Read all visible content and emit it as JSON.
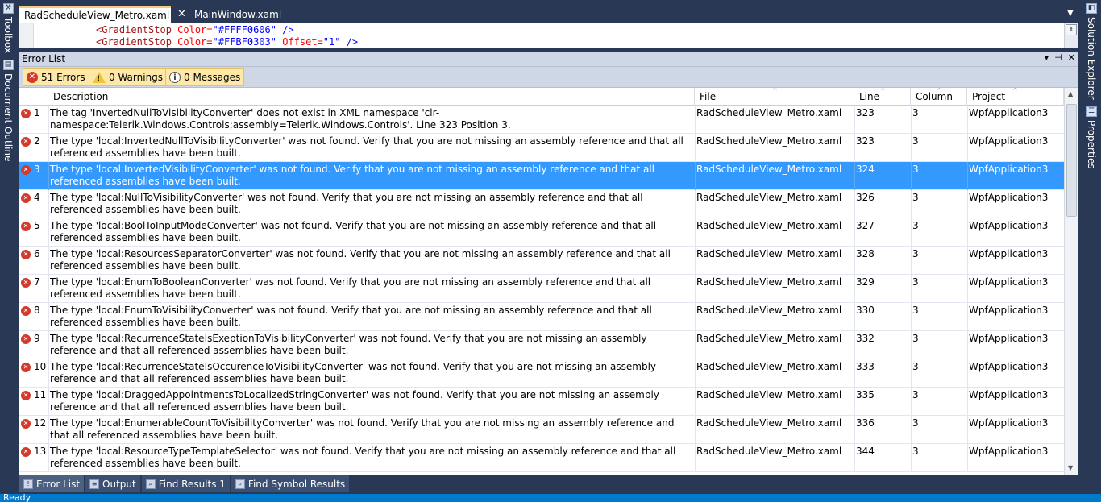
{
  "left_toolstrip": {
    "toolbox_label": "Toolbox",
    "doc_outline_label": "Document Outline"
  },
  "right_toolstrip": {
    "solution_explorer_label": "Solution Explorer",
    "properties_label": "Properties"
  },
  "doc_tabs": {
    "active": "RadScheduleView_Metro.xaml",
    "inactive": "MainWindow.xaml",
    "close_glyph": "✕",
    "dropdown_glyph": "▼"
  },
  "editor": {
    "lines": [
      {
        "tag": "<GradientStop",
        "attr": "Color=",
        "val": "\"#FFFF0606\"",
        "end": " />"
      },
      {
        "tag": "<GradientStop",
        "attr": "Color=",
        "val": "\"#FFBF0303\"",
        "attr2": " Offset=",
        "val2": "\"1\"",
        "end": " />"
      }
    ]
  },
  "error_list": {
    "title": "Error List",
    "controls": [
      "▾",
      "⊣",
      "✕"
    ],
    "filters": {
      "errors": "51 Errors",
      "warnings": "0 Warnings",
      "messages": "0 Messages"
    },
    "columns": {
      "description": "Description",
      "file": "File",
      "line": "Line",
      "column": "Column",
      "project": "Project"
    },
    "selected_index": 2,
    "rows": [
      {
        "num": "1",
        "desc": "The tag 'InvertedNullToVisibilityConverter' does not exist in XML namespace 'clr-namespace:Telerik.Windows.Controls;assembly=Telerik.Windows.Controls'. Line 323 Position 3.",
        "file": "RadScheduleView_Metro.xaml",
        "line": "323",
        "column": "3",
        "project": "WpfApplication3"
      },
      {
        "num": "2",
        "desc": "The type 'local:InvertedNullToVisibilityConverter' was not found. Verify that you are not missing an assembly reference and that all referenced assemblies have been built.",
        "file": "RadScheduleView_Metro.xaml",
        "line": "323",
        "column": "3",
        "project": "WpfApplication3"
      },
      {
        "num": "3",
        "desc": "The type 'local:InvertedVisibilityConverter' was not found. Verify that you are not missing an assembly reference and that all referenced assemblies have been built.",
        "file": "RadScheduleView_Metro.xaml",
        "line": "324",
        "column": "3",
        "project": "WpfApplication3"
      },
      {
        "num": "4",
        "desc": "The type 'local:NullToVisibilityConverter' was not found. Verify that you are not missing an assembly reference and that all referenced assemblies have been built.",
        "file": "RadScheduleView_Metro.xaml",
        "line": "326",
        "column": "3",
        "project": "WpfApplication3"
      },
      {
        "num": "5",
        "desc": "The type 'local:BoolToInputModeConverter' was not found. Verify that you are not missing an assembly reference and that all referenced assemblies have been built.",
        "file": "RadScheduleView_Metro.xaml",
        "line": "327",
        "column": "3",
        "project": "WpfApplication3"
      },
      {
        "num": "6",
        "desc": "The type 'local:ResourcesSeparatorConverter' was not found. Verify that you are not missing an assembly reference and that all referenced assemblies have been built.",
        "file": "RadScheduleView_Metro.xaml",
        "line": "328",
        "column": "3",
        "project": "WpfApplication3"
      },
      {
        "num": "7",
        "desc": "The type 'local:EnumToBooleanConverter' was not found. Verify that you are not missing an assembly reference and that all referenced assemblies have been built.",
        "file": "RadScheduleView_Metro.xaml",
        "line": "329",
        "column": "3",
        "project": "WpfApplication3"
      },
      {
        "num": "8",
        "desc": "The type 'local:EnumToVisibilityConverter' was not found. Verify that you are not missing an assembly reference and that all referenced assemblies have been built.",
        "file": "RadScheduleView_Metro.xaml",
        "line": "330",
        "column": "3",
        "project": "WpfApplication3"
      },
      {
        "num": "9",
        "desc": "The type 'local:RecurrenceStateIsExeptionToVisibilityConverter' was not found. Verify that you are not missing an assembly reference and that all referenced assemblies have been built.",
        "file": "RadScheduleView_Metro.xaml",
        "line": "332",
        "column": "3",
        "project": "WpfApplication3"
      },
      {
        "num": "10",
        "desc": "The type 'local:RecurrenceStateIsOccurenceToVisibilityConverter' was not found. Verify that you are not missing an assembly reference and that all referenced assemblies have been built.",
        "file": "RadScheduleView_Metro.xaml",
        "line": "333",
        "column": "3",
        "project": "WpfApplication3"
      },
      {
        "num": "11",
        "desc": "The type 'local:DraggedAppointmentsToLocalizedStringConverter' was not found. Verify that you are not missing an assembly reference and that all referenced assemblies have been built.",
        "file": "RadScheduleView_Metro.xaml",
        "line": "335",
        "column": "3",
        "project": "WpfApplication3"
      },
      {
        "num": "12",
        "desc": "The type 'local:EnumerableCountToVisibilityConverter' was not found. Verify that you are not missing an assembly reference and that all referenced assemblies have been built.",
        "file": "RadScheduleView_Metro.xaml",
        "line": "336",
        "column": "3",
        "project": "WpfApplication3"
      },
      {
        "num": "13",
        "desc": "The type 'local:ResourceTypeTemplateSelector' was not found. Verify that you are not missing an assembly reference and that all referenced assemblies have been built.",
        "file": "RadScheduleView_Metro.xaml",
        "line": "344",
        "column": "3",
        "project": "WpfApplication3"
      }
    ]
  },
  "bottom_tabs": [
    "Error List",
    "Output",
    "Find Results 1",
    "Find Symbol Results"
  ],
  "status": {
    "text": "Ready"
  },
  "colors": {
    "selected_row": "#3399ff",
    "chrome": "#293955",
    "error_red": "#d33a2c",
    "active_tab_accent": "#f5cc84"
  }
}
